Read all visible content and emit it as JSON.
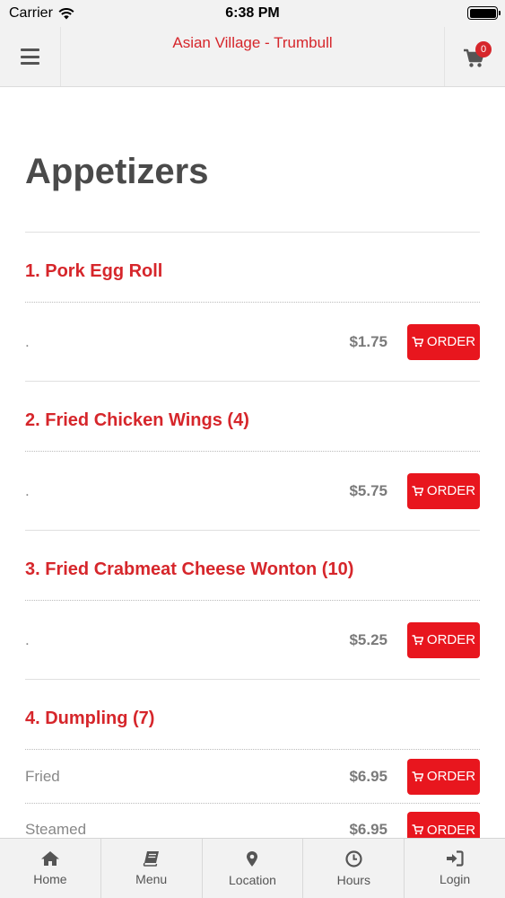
{
  "status_bar": {
    "carrier": "Carrier",
    "time": "6:38 PM"
  },
  "header": {
    "title": "Asian Village - Trumbull",
    "cart_count": "0"
  },
  "section": {
    "title": "Appetizers"
  },
  "order_label": "ORDER",
  "items": [
    {
      "name": "1. Pork Egg Roll",
      "rows": [
        {
          "desc": ".",
          "price": "$1.75"
        }
      ]
    },
    {
      "name": "2. Fried Chicken Wings (4)",
      "rows": [
        {
          "desc": ".",
          "price": "$5.75"
        }
      ]
    },
    {
      "name": "3. Fried Crabmeat Cheese Wonton (10)",
      "rows": [
        {
          "desc": ".",
          "price": "$5.25"
        }
      ]
    },
    {
      "name": "4. Dumpling (7)",
      "rows": [
        {
          "desc": "Fried",
          "price": "$6.95"
        },
        {
          "desc": "Steamed",
          "price": "$6.95"
        }
      ]
    }
  ],
  "tabs": [
    {
      "label": "Home",
      "icon": "home-icon"
    },
    {
      "label": "Menu",
      "icon": "book-icon"
    },
    {
      "label": "Location",
      "icon": "map-pin-icon"
    },
    {
      "label": "Hours",
      "icon": "clock-icon"
    },
    {
      "label": "Login",
      "icon": "login-icon"
    }
  ],
  "colors": {
    "brand_red": "#d6262b",
    "button_red": "#e8161e",
    "header_bg": "#f2f2f2"
  }
}
